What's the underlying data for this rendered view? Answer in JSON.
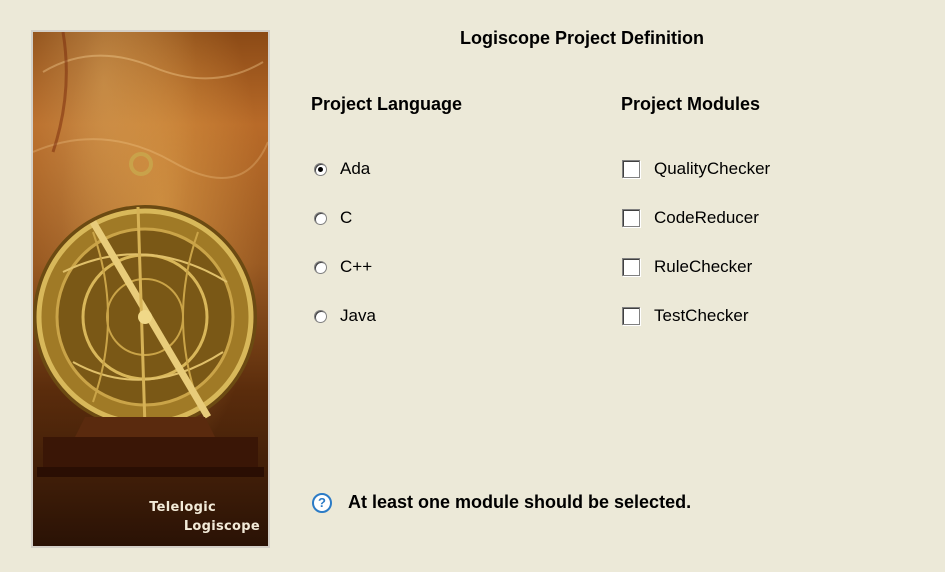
{
  "banner": {
    "line1": "Telelogic",
    "line2": "Logiscope"
  },
  "title": "Logiscope Project Definition",
  "language": {
    "heading": "Project Language",
    "options": [
      {
        "label": "Ada",
        "checked": true
      },
      {
        "label": "C",
        "checked": false
      },
      {
        "label": "C++",
        "checked": false
      },
      {
        "label": "Java",
        "checked": false
      }
    ]
  },
  "modules": {
    "heading": "Project Modules",
    "options": [
      {
        "label": "QualityChecker",
        "checked": false
      },
      {
        "label": "CodeReducer",
        "checked": false
      },
      {
        "label": "RuleChecker",
        "checked": false
      },
      {
        "label": "TestChecker",
        "checked": false
      }
    ]
  },
  "note": {
    "icon": "question-icon",
    "text": "At least one module should be selected."
  }
}
